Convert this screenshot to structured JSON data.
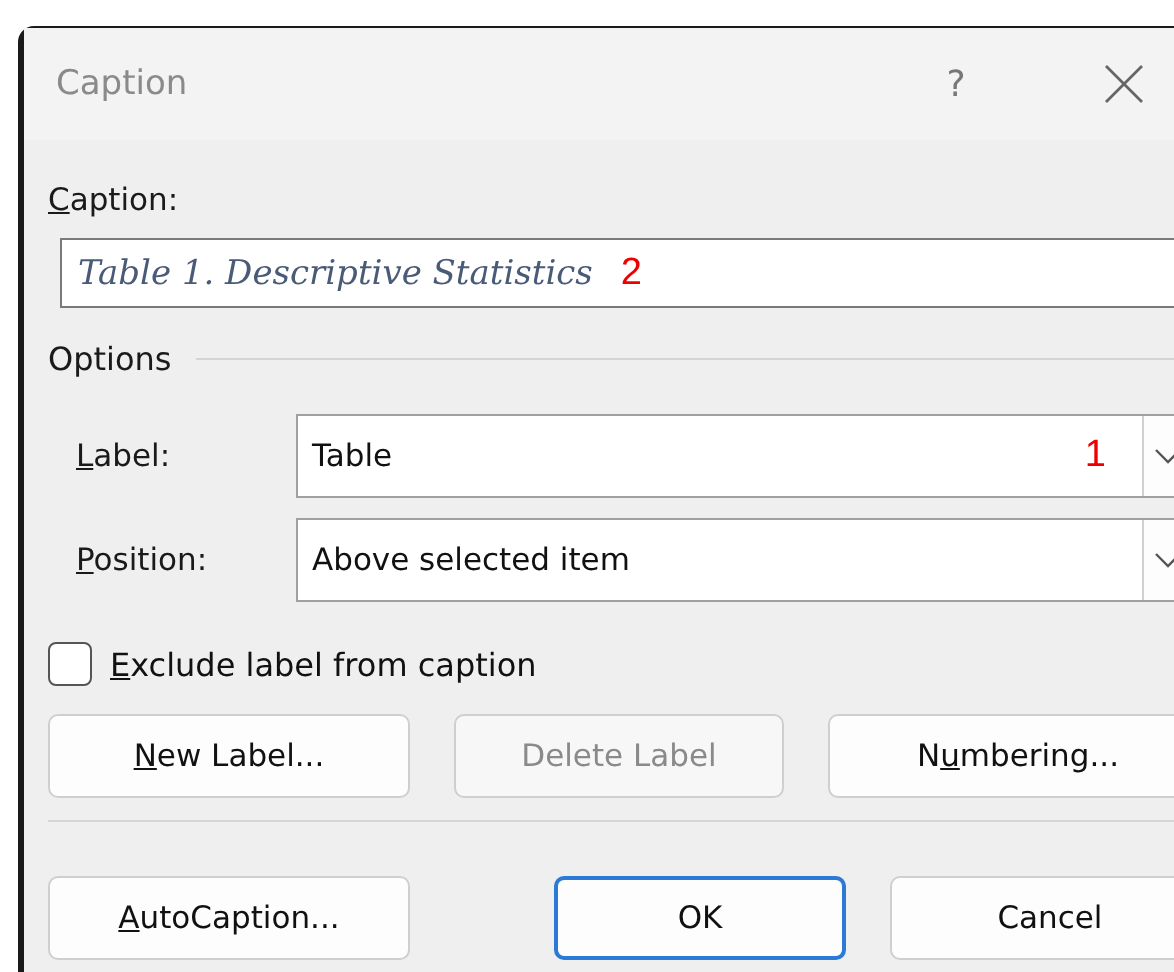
{
  "window": {
    "title": "Caption",
    "help": "?"
  },
  "caption": {
    "label": {
      "key": "C",
      "rest": "aption:"
    },
    "value": "Table 1. Descriptive Statistics",
    "annotation": "2"
  },
  "options": {
    "title": "Options",
    "fields": [
      {
        "label": {
          "key": "L",
          "rest": "abel:"
        },
        "value": "Table",
        "annotation": "1"
      },
      {
        "label": {
          "key": "P",
          "rest": "osition:"
        },
        "value": "Above selected item"
      }
    ]
  },
  "exclude": {
    "label": {
      "key": "E",
      "rest": "xclude label from caption"
    },
    "checked": false
  },
  "label_buttons": [
    {
      "label": {
        "key": "N",
        "rest": "ew Label..."
      },
      "disabled": false
    },
    {
      "label": {
        "rest": "Delete Label"
      },
      "disabled": true
    },
    {
      "label": {
        "lead": "N",
        "key": "u",
        "rest": "mbering..."
      },
      "disabled": false
    }
  ],
  "footer_buttons": [
    {
      "label": {
        "key": "A",
        "rest": "utoCaption..."
      },
      "default": false
    },
    {
      "label": {
        "rest": "OK"
      },
      "default": true
    },
    {
      "label": {
        "rest": "Cancel"
      },
      "default": false
    }
  ]
}
